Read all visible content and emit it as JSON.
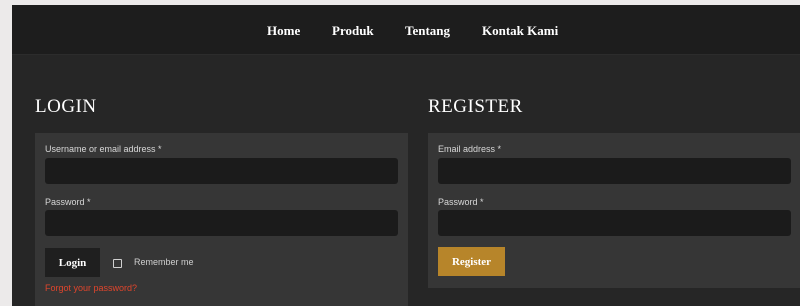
{
  "nav": {
    "items": [
      {
        "label": "Home"
      },
      {
        "label": "Produk"
      },
      {
        "label": "Tentang"
      },
      {
        "label": "Kontak Kami"
      }
    ]
  },
  "login": {
    "title": "LOGIN",
    "username_label": "Username or email address *",
    "username_value": "",
    "password_label": "Password *",
    "password_value": "",
    "button_label": "Login",
    "remember_label": "Remember me",
    "remember_checked": false,
    "forgot_label": "Forgot your password?"
  },
  "register": {
    "title": "REGISTER",
    "email_label": "Email address *",
    "email_value": "",
    "password_label": "Password *",
    "password_value": "",
    "button_label": "Register"
  },
  "colors": {
    "background": "#262626",
    "header": "#1d1d1d",
    "panel": "#363636",
    "input": "#1b1b1b",
    "register_button": "#b7852a",
    "forgot_link": "#e0452c"
  }
}
